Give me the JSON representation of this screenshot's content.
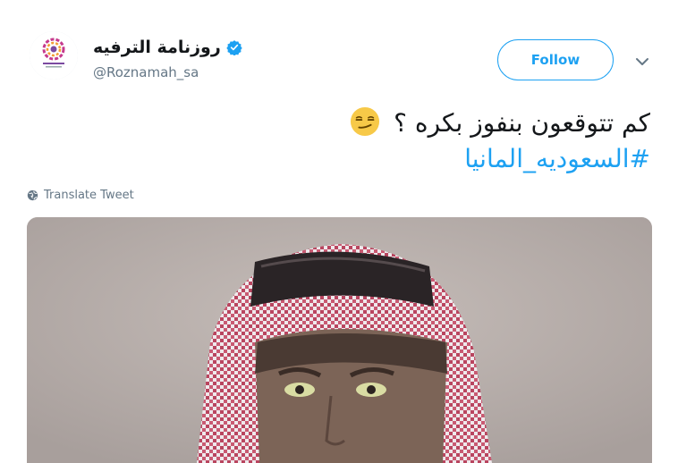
{
  "account": {
    "display_name": "روزنامة الترفيه",
    "handle": "@Roznamah_sa",
    "verified": true
  },
  "actions": {
    "follow_label": "Follow",
    "more_icon": "chevron-down-icon"
  },
  "tweet": {
    "text_line": "كم تتوقعون بنفوز بكره ؟",
    "emoji": "smirking-face",
    "hashtag": "#السعوديه_المانيا"
  },
  "translate": {
    "label": "Translate Tweet",
    "icon": "globe-icon"
  },
  "colors": {
    "accent": "#1da1f2",
    "secondary_text": "#657786",
    "primary_text": "#14171a"
  }
}
